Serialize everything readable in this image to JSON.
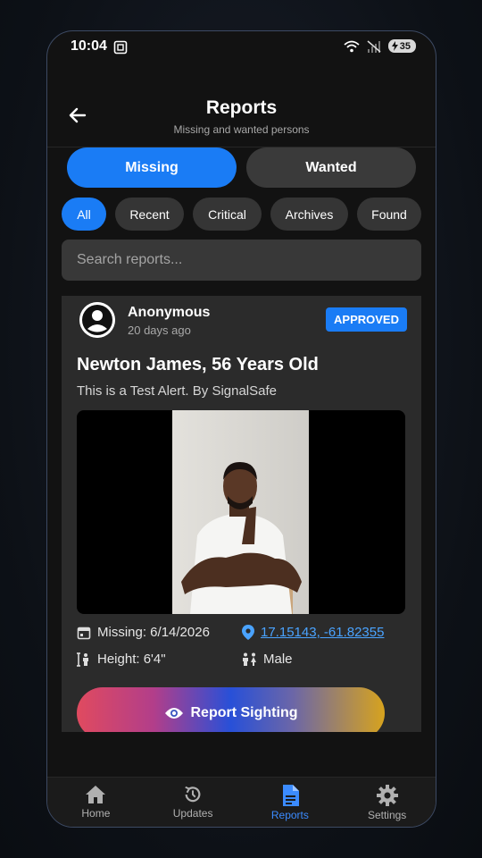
{
  "status": {
    "time": "10:04",
    "battery": "35"
  },
  "header": {
    "title": "Reports",
    "subtitle": "Missing and wanted persons"
  },
  "toggle": {
    "missing": "Missing",
    "wanted": "Wanted"
  },
  "chips": [
    "All",
    "Recent",
    "Critical",
    "Archives",
    "Found"
  ],
  "search": {
    "placeholder": "Search reports..."
  },
  "card": {
    "author": "Anonymous",
    "time_ago": "20 days ago",
    "badge": "APPROVED",
    "name": "Newton James, 56 Years Old",
    "description": "This is a Test Alert. By SignalSafe",
    "missing_date": "Missing: 6/14/2026",
    "location": "17.15143, -61.82355",
    "height": "Height: 6'4\"",
    "gender": "Male",
    "cta": "Report Sighting"
  },
  "nav": {
    "home": "Home",
    "updates": "Updates",
    "reports": "Reports",
    "settings": "Settings"
  },
  "colors": {
    "accent": "#1a7cf5",
    "background": "#121212",
    "card": "#2b2b2b",
    "link": "#4aa3ff"
  }
}
